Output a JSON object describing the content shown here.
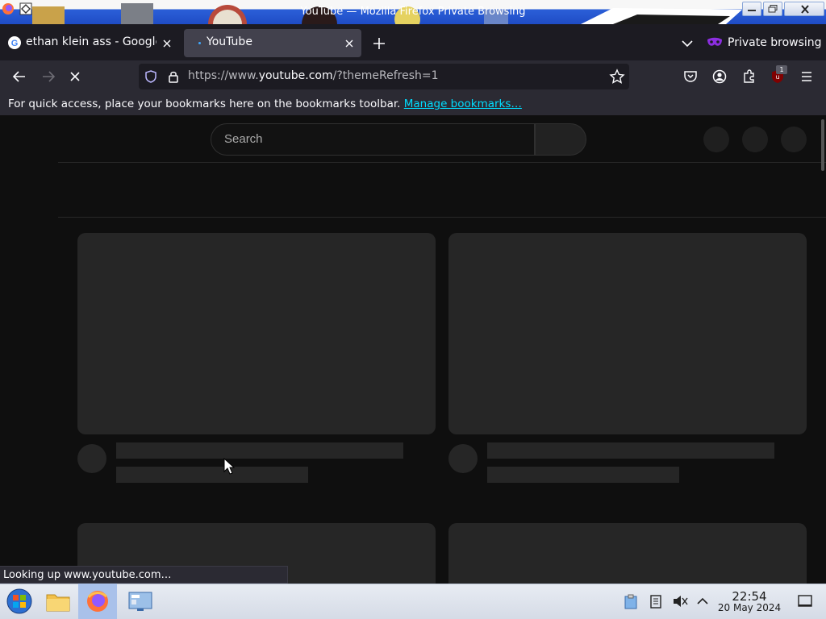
{
  "window": {
    "title": "YouTube — Mozilla Firefox Private Browsing"
  },
  "tabs": [
    {
      "title": "ethan klein ass - Google",
      "active": false
    },
    {
      "title": "YouTube",
      "active": true
    }
  ],
  "private_browsing": {
    "label": "Private browsing"
  },
  "navigation": {
    "url_prefix": "https://www.",
    "url_domain": "youtube.com",
    "url_suffix": "/?themeRefresh=1",
    "extension_badge": "1"
  },
  "bookmarks_toolbar": {
    "message": "For quick access, place your bookmarks here on the bookmarks toolbar.",
    "link": "Manage bookmarks…"
  },
  "youtube": {
    "search_placeholder": "Search"
  },
  "status": {
    "text": "Looking up www.youtube.com…"
  },
  "taskbar": {
    "time": "22:54",
    "date": "20 May 2024"
  },
  "colors": {
    "firefox_dark": "#1c1b22",
    "firefox_toolbar": "#2b2a33",
    "youtube_bg": "#0f0f0f",
    "skeleton": "#262626",
    "link": "#00ddff",
    "private_purple": "#8c2ee0"
  }
}
